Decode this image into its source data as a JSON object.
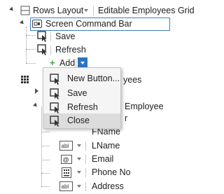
{
  "toolbar": {
    "layout_label": "Rows Layout",
    "grid_label": "Editable Employees Grid"
  },
  "command_bar": {
    "label": "Screen Command Bar",
    "items": [
      "Save",
      "Refresh"
    ],
    "add_label": "Add"
  },
  "add_menu": {
    "items": [
      {
        "label": "New Button..."
      },
      {
        "label": "Save"
      },
      {
        "label": "Refresh"
      },
      {
        "label": "Close"
      }
    ]
  },
  "partial": {
    "text_a": "yees",
    "text_b": "Employee",
    "text_c": "r",
    "text_d": "FName"
  },
  "fields": [
    {
      "label": "LName"
    },
    {
      "label": "Email"
    },
    {
      "label": "Phone No"
    },
    {
      "label": "Address"
    }
  ],
  "colors": {
    "accent": "#2f73c0",
    "highlight": "#dcdcdc",
    "add_green": "#3aa33a"
  }
}
